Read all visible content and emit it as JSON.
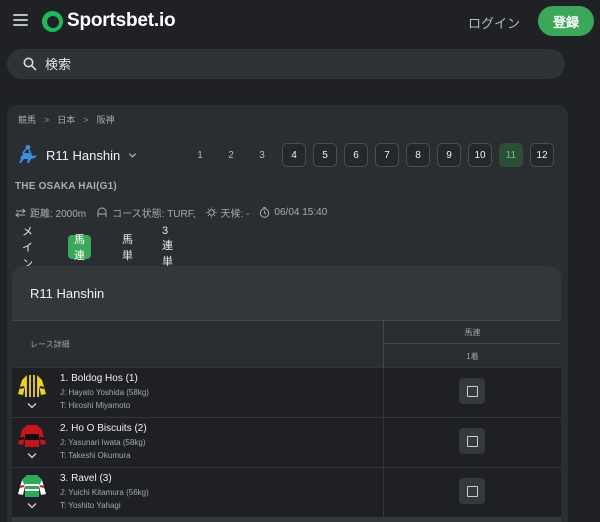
{
  "header": {
    "logo_text": "Sportsbet.io",
    "login_label": "ログイン",
    "register_label": "登録"
  },
  "search": {
    "placeholder": "検索"
  },
  "breadcrumb": [
    "競馬",
    "日本",
    "阪神"
  ],
  "race": {
    "title": "R11 Hanshin",
    "name": "THE OSAKA HAI(G1)",
    "numbers": [
      "1",
      "2",
      "3",
      "4",
      "5",
      "6",
      "7",
      "8",
      "9",
      "10",
      "11",
      "12"
    ],
    "active_number": "11",
    "distance": "距離: 2000m",
    "course": "コース状態: TURF,",
    "weather": "天候: -",
    "datetime": "06/04 15:40"
  },
  "tabs": [
    {
      "label": "メイン",
      "active": false
    },
    {
      "label": "馬連",
      "active": true
    },
    {
      "label": "馬単",
      "active": false
    },
    {
      "label": "3連単",
      "active": false
    }
  ],
  "market": {
    "title": "R11 Hanshin",
    "col_details": "レース詳細",
    "col_market": "馬連",
    "col_pick": "1着"
  },
  "runners": [
    {
      "name": "1. Boldog Hos (1)",
      "jockey": "J: Hayato Yoshida (58kg)",
      "trainer": "T: Hiroshi Miyamoto",
      "silk_colors": [
        "#f2d21a",
        "#1a1a4a"
      ]
    },
    {
      "name": "2. Ho O Biscuits (2)",
      "jockey": "J: Yasunari Iwata (58kg)",
      "trainer": "T: Takeshi Okumura",
      "silk_colors": [
        "#c8141e",
        "#111111"
      ]
    },
    {
      "name": "3. Ravel (3)",
      "jockey": "J: Yuichi Kitamura (56kg)",
      "trainer": "T: Yoshito Yahagi",
      "silk_colors": [
        "#2fa85a",
        "#ffffff"
      ]
    }
  ],
  "colors": {
    "accent": "#3aa858",
    "background": "#1f2125",
    "panel": "#2a2d31"
  }
}
